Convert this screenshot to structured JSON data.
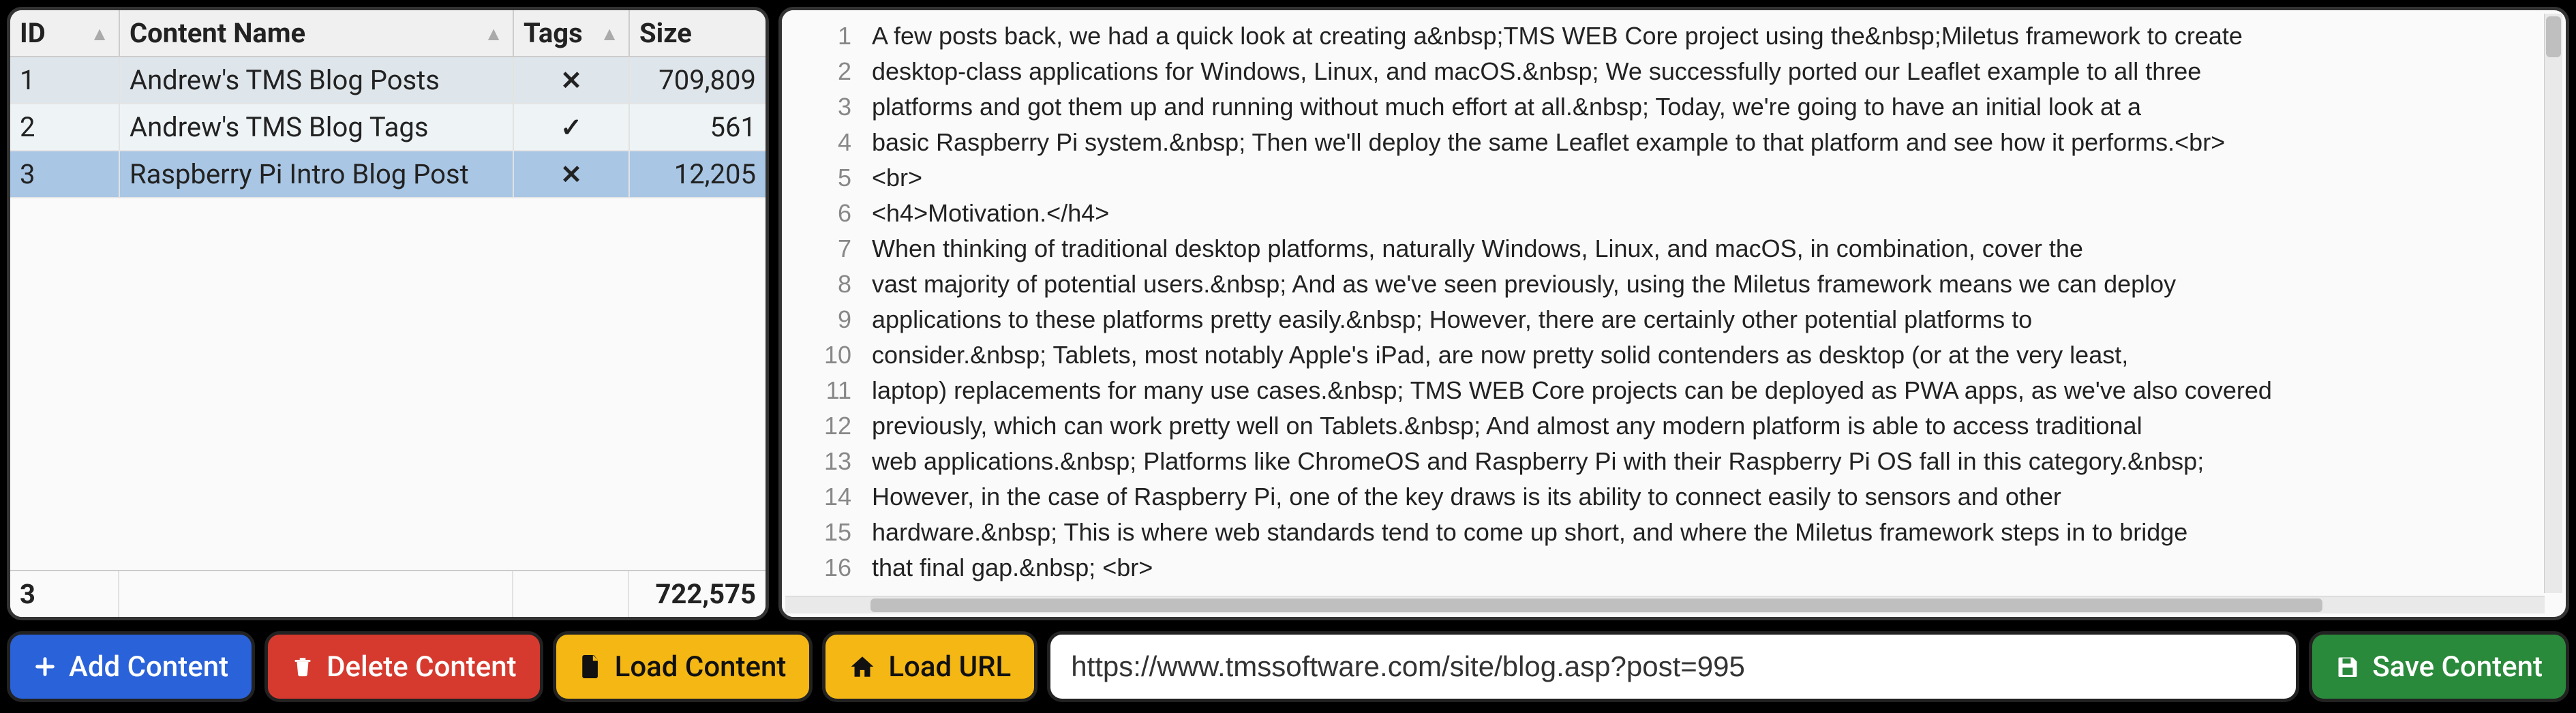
{
  "table": {
    "headers": {
      "id": "ID",
      "name": "Content Name",
      "tags": "Tags",
      "size": "Size"
    },
    "rows": [
      {
        "id": "1",
        "name": "Andrew's TMS Blog Posts",
        "tags": "x",
        "size": "709,809",
        "selected": false
      },
      {
        "id": "2",
        "name": "Andrew's TMS Blog Tags",
        "tags": "check",
        "size": "561",
        "selected": false
      },
      {
        "id": "3",
        "name": "Raspberry Pi Intro Blog Post",
        "tags": "x",
        "size": "12,205",
        "selected": true
      }
    ],
    "footer": {
      "count": "3",
      "total": "722,575"
    }
  },
  "editor_lines": [
    "A few posts back, we had a quick look at creating a&nbsp;TMS WEB Core project using the&nbsp;Miletus framework to create",
    "desktop-class applications for Windows, Linux, and macOS.&nbsp; We successfully ported our Leaflet example to all three",
    "platforms and got them up and running without much effort at all.&nbsp; Today, we're going to have an initial look at a",
    "basic Raspberry Pi system.&nbsp; Then we'll deploy the same Leaflet example to that platform and see how it performs.<br>",
    "<br>",
    "<h4>Motivation.</h4>",
    "When thinking of traditional desktop platforms, naturally Windows, Linux, and macOS, in combination, cover the",
    "vast majority of potential users.&nbsp; And as we've seen previously, using the Miletus framework means we can deploy",
    "applications to these platforms pretty easily.&nbsp; However, there are certainly other potential platforms to",
    "consider.&nbsp; Tablets, most notably Apple's iPad, are now pretty solid contenders as desktop (or at the very least,",
    "laptop) replacements for many use cases.&nbsp; TMS WEB Core projects can be deployed as PWA apps, as we've also covered",
    "previously, which can work pretty well on Tablets.&nbsp; And almost any modern platform is able to access traditional",
    "web applications.&nbsp; Platforms like ChromeOS and Raspberry Pi with their Raspberry Pi OS fall in this category.&nbsp;",
    "However, in the case of Raspberry Pi, one of the key draws is its ability to connect easily to sensors and other",
    "hardware.&nbsp; This is where web standards tend to come up short, and where the Miletus framework steps in to bridge",
    "that final gap.&nbsp; <br>"
  ],
  "buttons": {
    "add": "Add Content",
    "delete": "Delete Content",
    "load_content": "Load Content",
    "load_url": "Load URL",
    "save": "Save Content"
  },
  "url": "https://www.tmssoftware.com/site/blog.asp?post=995",
  "glyphs": {
    "x": "✕",
    "check": "✓"
  }
}
